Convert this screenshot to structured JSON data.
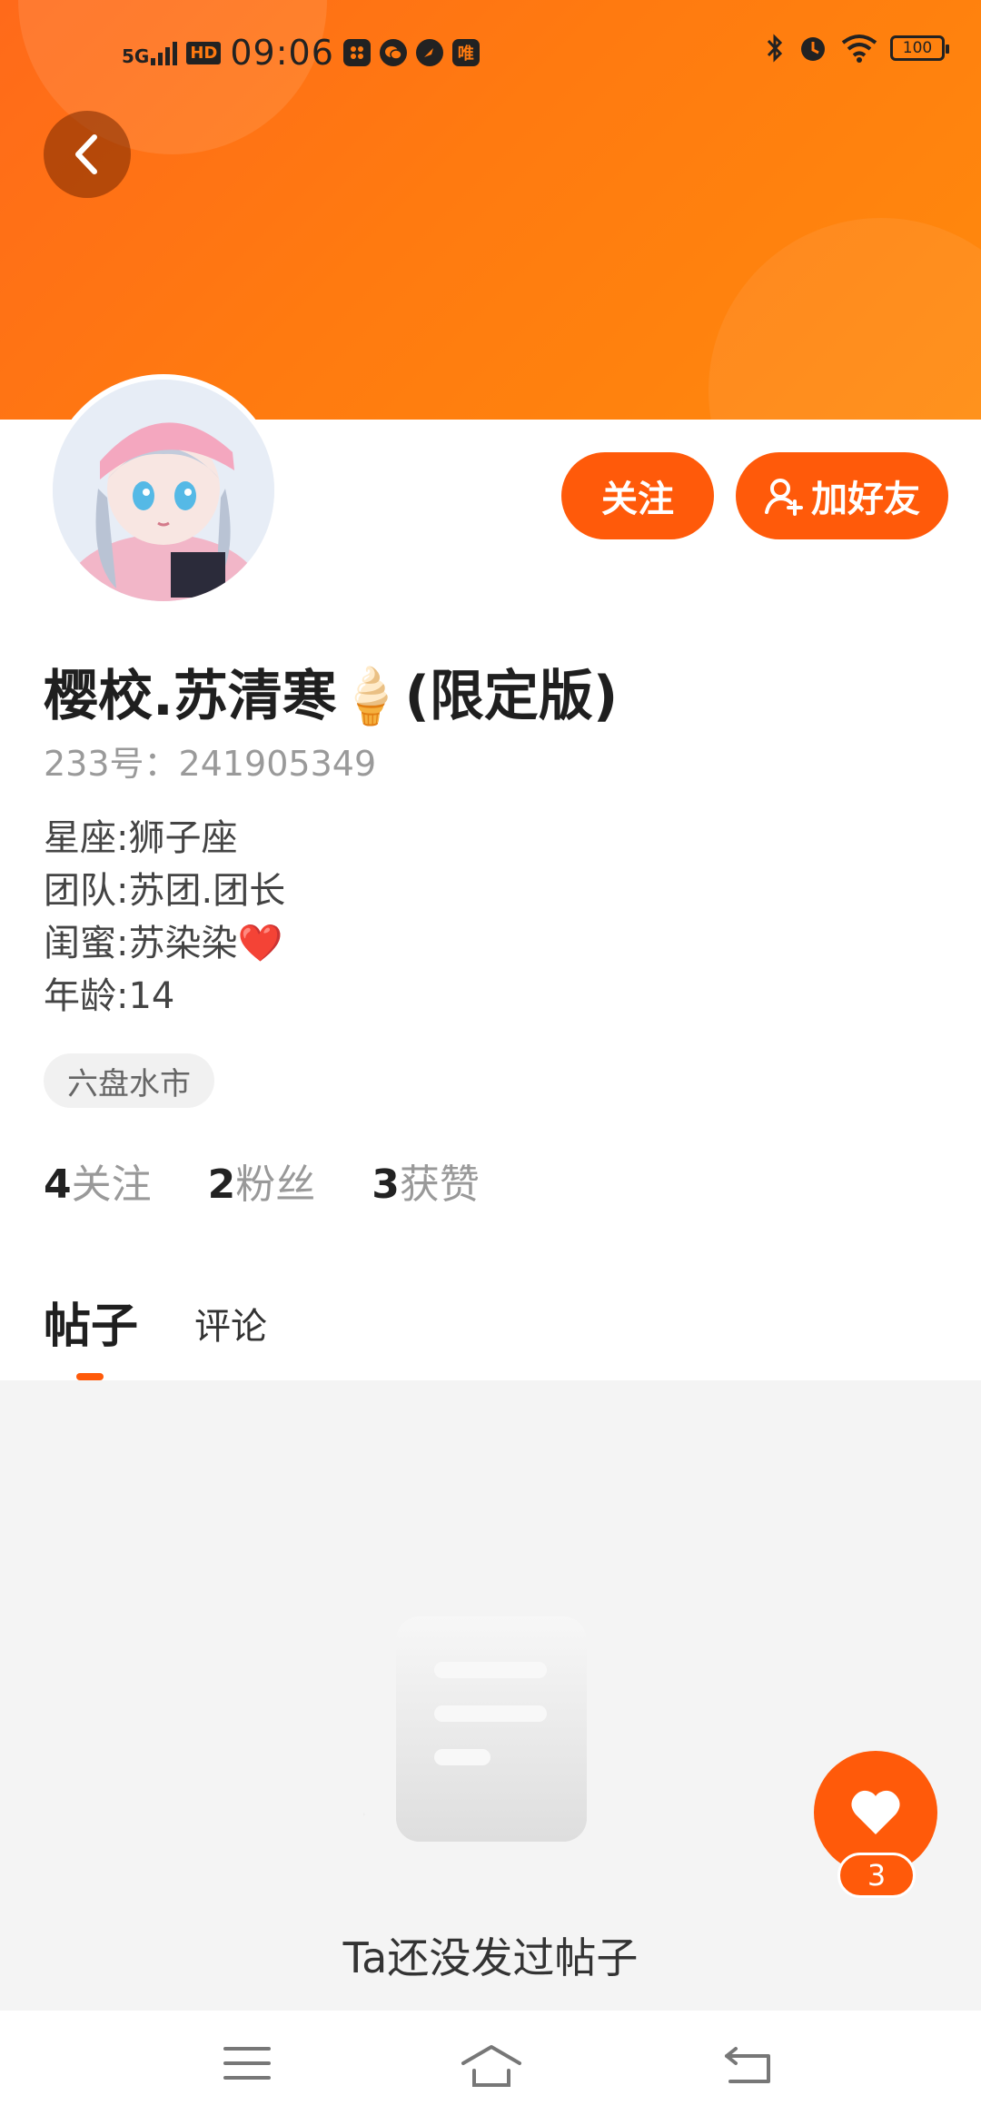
{
  "status_bar": {
    "network": "5G",
    "hd": "HD",
    "time": "09:06",
    "app_icons": [
      "app-notification-icon",
      "wechat-icon",
      "speed-icon",
      "vip-app-icon"
    ],
    "app_icon_labels": [
      "",
      "",
      "",
      "唯"
    ],
    "battery": "100"
  },
  "profile": {
    "name": "樱校.苏清寒🍦(限定版)",
    "id_label": "233号：",
    "id_value": "241905349",
    "bio": [
      "星座:狮子座",
      "团队:苏团.团长",
      "闺蜜:苏染染❤️",
      "年龄:14"
    ],
    "location_tag": "六盘水市"
  },
  "actions": {
    "follow_label": "关注",
    "add_friend_label": "加好友"
  },
  "stats": [
    {
      "num": "4",
      "label": "关注"
    },
    {
      "num": "2",
      "label": "粉丝"
    },
    {
      "num": "3",
      "label": "获赞"
    }
  ],
  "tabs": {
    "posts": "帖子",
    "comments": "评论"
  },
  "empty_state": {
    "text": "Ta还没发过帖子"
  },
  "like_button": {
    "count": "3"
  },
  "colors": {
    "accent": "#ff5a0a",
    "header": "#ff7a10"
  }
}
